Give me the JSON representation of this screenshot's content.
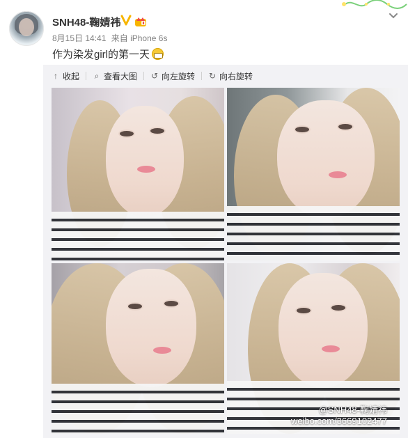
{
  "post": {
    "username": "SNH48-鞠婧祎",
    "date": "8月15日 14:41",
    "source": "来自 iPhone 6s",
    "text": "作为染发girl的第一天",
    "emoji": "grin-emoji"
  },
  "toolbar": {
    "collapse": "收起",
    "view_large": "查看大图",
    "rotate_left": "向左旋转",
    "rotate_right": "向右旋转"
  },
  "photos": [
    {
      "label": "photo-1"
    },
    {
      "label": "photo-2"
    },
    {
      "label": "photo-3"
    },
    {
      "label": "photo-4"
    }
  ],
  "watermark": {
    "line1": "@SNH48-鞠婧祎",
    "line2": "weibo.com/3669102477"
  },
  "colors": {
    "accent_verified": "#f7b500",
    "panel_bg": "#f2f2f5",
    "meta_text": "#808080"
  }
}
